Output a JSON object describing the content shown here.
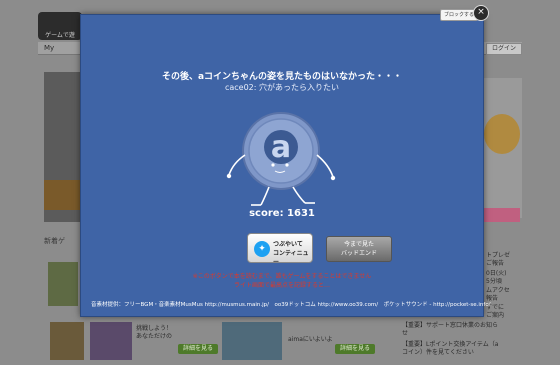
{
  "background": {
    "badge": "ゲームで遊",
    "mypage": "My",
    "login": "ログイン",
    "new_games": "新着ゲ",
    "thumb1_text": "挑戦しよう！\nあなただけの",
    "thumb2_text": "aimaにいよいよ",
    "play_button": "詳細を見る",
    "right_list": [
      "トプレゼ",
      "ご報告",
      "0日(火)",
      "5分頃",
      "ムアクセ",
      "報告",
      "すでに",
      "ご案内"
    ],
    "news": [
      "【重要】サポート窓口休業のお知ら",
      "せ",
      "【重要】Lポイント交換アイテム（a",
      "コイン）件を見てください"
    ]
  },
  "modal": {
    "block_label": "ブロックする",
    "close_label": "×",
    "message_main": "その後、aコインちゃんの姿を見たものはいなかった・・・",
    "message_sub": "cace02:  穴があったら入りたい",
    "score_text": "score: 1631",
    "share_button_line1": "つぶやいて",
    "share_button_line2": "コンティニュー",
    "bad_end_line1": "今まで見た",
    "bad_end_line2": "バッドエンド",
    "warning_line1": "※このボタンで本を読むまで、誰もゲームをすることはできません",
    "warning_line2": "ライト画面で最高点を記録すると…",
    "credits_label": "音素材提供：フリーBGM・音楽素材MusMus http://musmus.main.jp/　oo39ドットコム http://www.oo39.com/　ポケットサウンド - http://pocket-se.info/",
    "twitter_icon": "twitter-bird-icon",
    "character_icon": "a-coin-character"
  },
  "colors": {
    "modal_bg": "#3f64a6",
    "warning": "#d83a2e",
    "twitter": "#1da1f2"
  }
}
